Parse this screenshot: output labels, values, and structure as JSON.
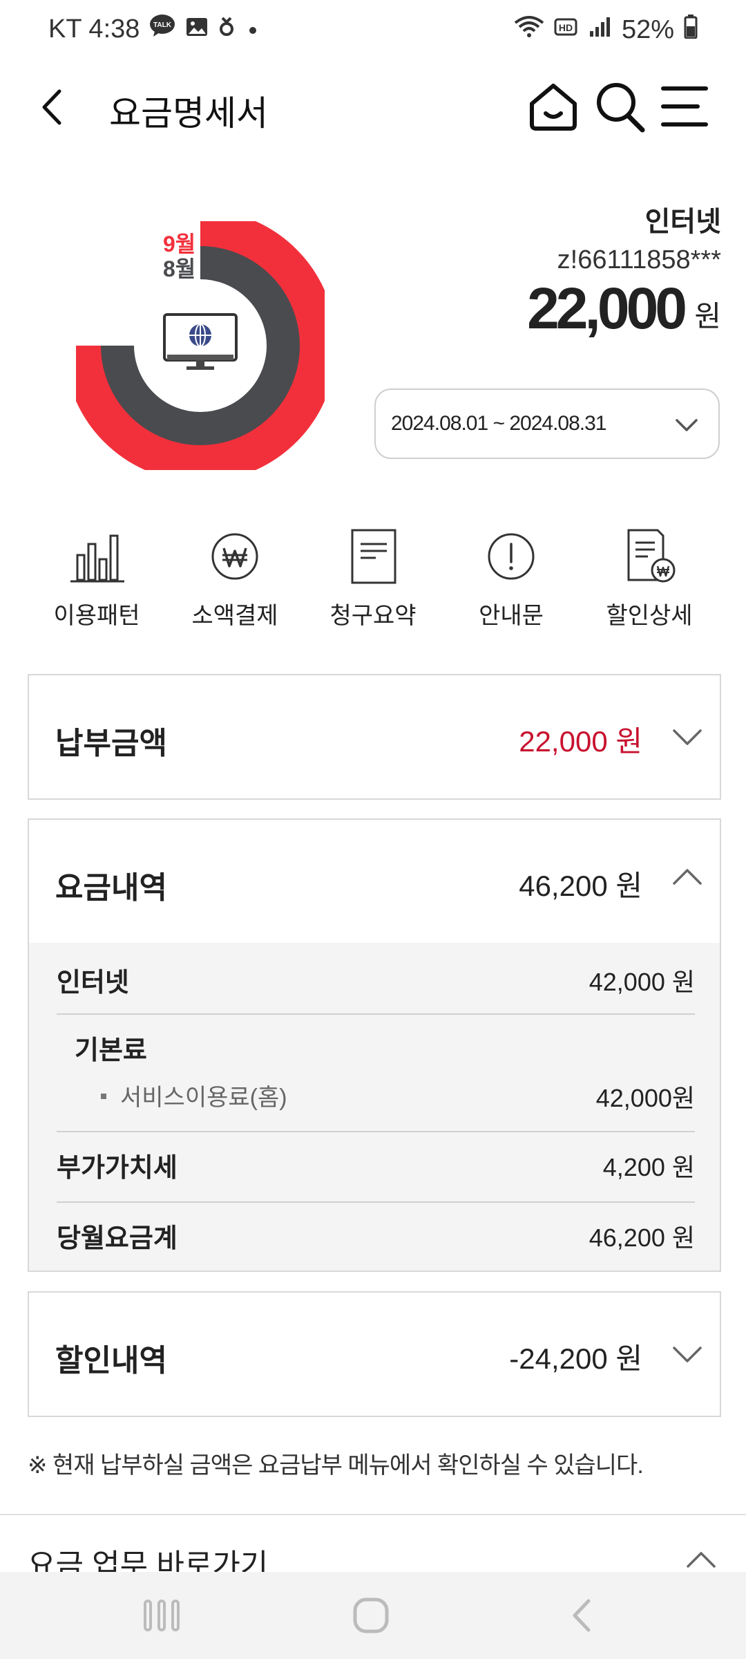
{
  "status_bar": {
    "carrier_time": "KT 4:38",
    "talk_badge": "TALK",
    "battery": "52%",
    "icons": [
      "chat-icon",
      "image-icon",
      "app-icon",
      "dot-icon",
      "wifi-icon",
      "hd-icon",
      "signal-icon",
      "battery-icon"
    ]
  },
  "header": {
    "title": "요금명세서",
    "icons": [
      "back-icon",
      "home-icon",
      "search-icon",
      "menu-icon"
    ]
  },
  "summary": {
    "current_month": "9월",
    "previous_month": "8월",
    "service_name": "인터넷",
    "account_id": "z!66111858***",
    "total_amount": "22,000",
    "unit": "원",
    "period": "2024.08.01 ~ 2024.08.31",
    "accent_color": "#f2303b",
    "dark_color": "#4a4b4f"
  },
  "quick_menu": [
    {
      "label": "이용패턴",
      "icon": "bar-chart-icon"
    },
    {
      "label": "소액결제",
      "icon": "won-coin-icon"
    },
    {
      "label": "청구요약",
      "icon": "document-icon"
    },
    {
      "label": "안내문",
      "icon": "notice-icon"
    },
    {
      "label": "할인상세",
      "icon": "discount-document-icon"
    }
  ],
  "payment": {
    "title": "납부금액",
    "amount": "22,000 원",
    "amount_color": "#c8102e"
  },
  "charges": {
    "title": "요금내역",
    "amount": "46,200 원",
    "items": {
      "internet_label": "인터넷",
      "internet_value": "42,000 원",
      "base_fee_label": "기본료",
      "service_fee_label": "서비스이용료(홈)",
      "service_fee_value": "42,000원",
      "vat_label": "부가가치세",
      "vat_value": "4,200 원",
      "monthly_total_label": "당월요금계",
      "monthly_total_value": "46,200 원"
    }
  },
  "discounts": {
    "title": "할인내역",
    "amount": "-24,200 원"
  },
  "notice": "※ 현재 납부하실 금액은 요금납부 메뉴에서 확인하실 수 있습니다.",
  "shortcut": {
    "title": "요금 업무 바로가기"
  },
  "system_nav": [
    "recent-apps-icon",
    "home-circle-icon",
    "back-arrow-icon"
  ]
}
